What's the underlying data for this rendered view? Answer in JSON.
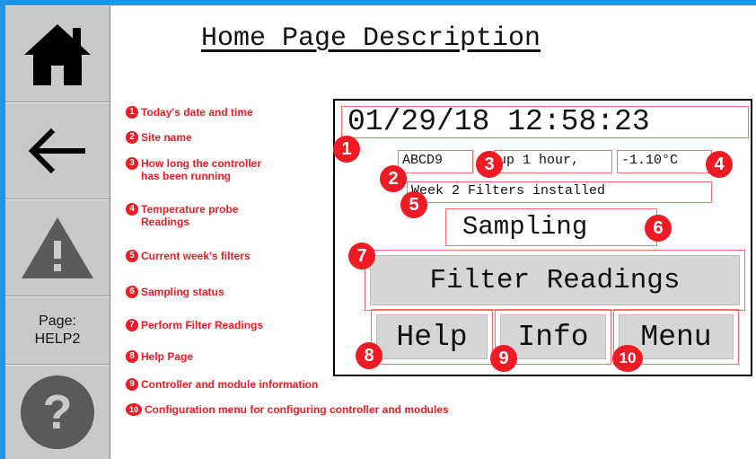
{
  "sidebar": {
    "home_icon": "home-icon",
    "back_icon": "back-arrow-icon",
    "warning_icon": "warning-icon",
    "page_label": "Page:",
    "page_value": "HELP2",
    "help_icon": "question-icon"
  },
  "title": "Home Page Description",
  "legend": [
    {
      "num": "1",
      "text": "Today's date and time",
      "cont": ""
    },
    {
      "num": "2",
      "text": "Site name",
      "cont": ""
    },
    {
      "num": "3",
      "text": "How long the controller",
      "cont": "has been running"
    },
    {
      "num": "4",
      "text": "Temperature probe",
      "cont": "Readings"
    },
    {
      "num": "5",
      "text": "Current week's filters",
      "cont": ""
    },
    {
      "num": "6",
      "text": "Sampling status",
      "cont": ""
    },
    {
      "num": "7",
      "text": "Perform Filter Readings",
      "cont": ""
    },
    {
      "num": "8",
      "text": "Help Page",
      "cont": ""
    },
    {
      "num": "9",
      "text": "Controller and module information",
      "cont": ""
    },
    {
      "num": "10",
      "text": "Configuration menu for configuring controller and modules",
      "cont": ""
    }
  ],
  "screen": {
    "datetime": "01/29/18 12:58:23",
    "site": "ABCD9",
    "uptime": "up 1 hour,",
    "temperature": "-1.10°C",
    "week_filters": "Week 2 Filters installed",
    "sampling": "Sampling",
    "filter_button": "Filter Readings",
    "help_button": "Help",
    "info_button": "Info",
    "menu_button": "Menu"
  },
  "markers": [
    "1",
    "2",
    "3",
    "4",
    "5",
    "6",
    "7",
    "8",
    "9",
    "10"
  ],
  "colors": {
    "accent": "#1f95e8",
    "annotation": "#ee1b24",
    "sidebar": "#c9c9c9",
    "button": "#d6d6d6"
  }
}
